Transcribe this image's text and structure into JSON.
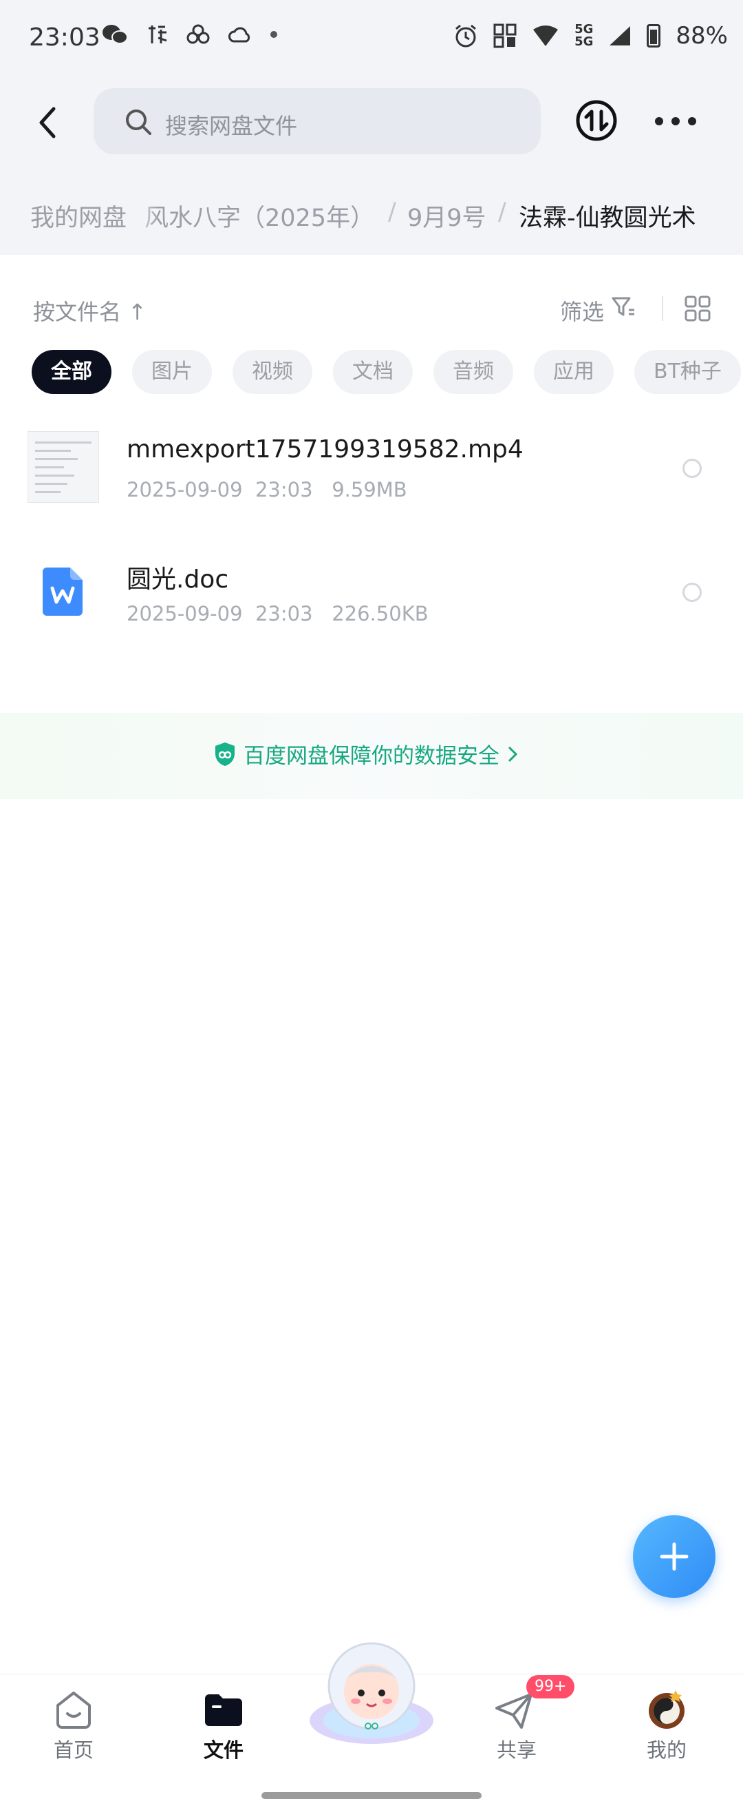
{
  "status_bar": {
    "time": "23:03",
    "battery": "88%",
    "network_top": "5G",
    "network_bottom": "5G",
    "left_icons": [
      "wechat-icon",
      "taobao-icon",
      "cloud-app-icon",
      "weather-icon",
      "dot-icon"
    ]
  },
  "search": {
    "placeholder": "搜索网盘文件"
  },
  "breadcrumb": {
    "items": [
      "我的网盘",
      "风水八字（2025年）",
      "9月9号",
      "法霖-仙教圆光术"
    ],
    "separator": "/"
  },
  "toolbar": {
    "sort_label": "按文件名",
    "sort_arrow": "↑",
    "filter_label": "筛选"
  },
  "chips": [
    "全部",
    "图片",
    "视频",
    "文档",
    "音频",
    "应用",
    "BT种子"
  ],
  "files": [
    {
      "name": "mmexport1757199319582.mp4",
      "date": "2025-09-09",
      "time": "23:03",
      "size": "9.59MB",
      "type": "video"
    },
    {
      "name": "圆光.doc",
      "date": "2025-09-09",
      "time": "23:03",
      "size": "226.50KB",
      "type": "word"
    }
  ],
  "safety_notice": "百度网盘保障你的数据安全",
  "tabs": [
    {
      "label": "首页",
      "icon": "home-icon",
      "active": false
    },
    {
      "label": "文件",
      "icon": "folder-icon",
      "active": true
    },
    {
      "label": "共享",
      "icon": "send-icon",
      "active": false,
      "badge": "99+"
    },
    {
      "label": "我的",
      "icon": "avatar-icon",
      "active": false
    }
  ],
  "colors": {
    "accent_green": "#17a87f",
    "fab_blue": "#2f8cf5",
    "chip_active": "#0b0f1e",
    "badge": "#ff4d6a"
  }
}
